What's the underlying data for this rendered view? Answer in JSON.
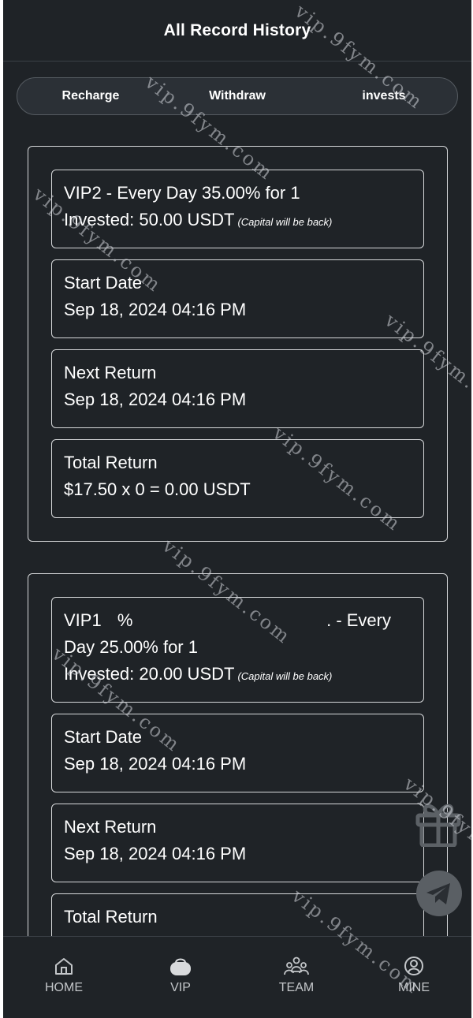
{
  "header": {
    "title": "All Record History"
  },
  "tabs": [
    {
      "label": "Recharge"
    },
    {
      "label": "Withdraw"
    },
    {
      "label": "invests"
    }
  ],
  "records": [
    {
      "plan_line": "VIP2 - Every Day 35.00% for 1",
      "invested": "Invested: 50.00 USDT",
      "capital_note": "(Capital will be back)",
      "start_label": "Start Date",
      "start_value": "Sep 18, 2024 04:16 PM",
      "next_label": "Next Return",
      "next_value": "Sep 18, 2024 04:16 PM",
      "total_label": "Total Return",
      "total_value": "$17.50 x 0 = 0.00 USDT"
    },
    {
      "plan_line_a": "VIP1 ",
      "plan_line_a_fragment": "%",
      "plan_line_a_end": ". - Every",
      "plan_line_b": "Day 25.00% for 1",
      "invested": "Invested: 20.00 USDT",
      "capital_note": "(Capital will be back)",
      "start_label": "Start Date",
      "start_value": "Sep 18, 2024 04:16 PM",
      "next_label": "Next Return",
      "next_value": "Sep 18, 2024 04:16 PM",
      "total_label": "Total Return"
    }
  ],
  "nav": [
    {
      "label": "HOME",
      "icon": "home-icon"
    },
    {
      "label": "VIP",
      "icon": "vip-basket-icon"
    },
    {
      "label": "TEAM",
      "icon": "team-icon"
    },
    {
      "label": "MINE",
      "icon": "user-icon"
    }
  ],
  "floating": {
    "gift_icon": "gift-icon",
    "telegram_icon": "telegram-icon"
  },
  "watermark": {
    "text": "vip.9fym.com"
  },
  "colors": {
    "background": "#1f2327",
    "border": "#d6d8da",
    "text": "#ffffff",
    "nav_text": "#c3c6c9"
  }
}
